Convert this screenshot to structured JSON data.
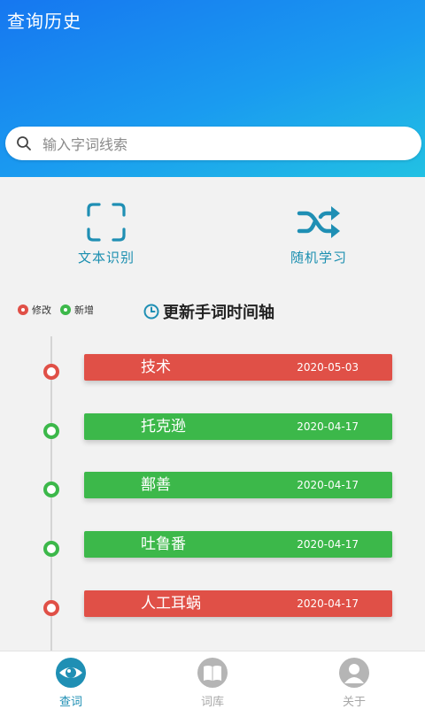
{
  "header": {
    "title": "查询历史"
  },
  "search": {
    "placeholder": "输入字词线索"
  },
  "actions": [
    {
      "label": "文本识别",
      "icon": "scan-frame-icon"
    },
    {
      "label": "随机学习",
      "icon": "shuffle-icon"
    }
  ],
  "legend": [
    {
      "label": "修改",
      "color": "#e05047"
    },
    {
      "label": "新增",
      "color": "#3cb84a"
    }
  ],
  "timeline": {
    "title": "更新手词时间轴",
    "entries": [
      {
        "word": "技术",
        "date": "2020-05-03",
        "status": "修改"
      },
      {
        "word": "托克逊",
        "date": "2020-04-17",
        "status": "新增"
      },
      {
        "word": "鄯善",
        "date": "2020-04-17",
        "status": "新增"
      },
      {
        "word": "吐鲁番",
        "date": "2020-04-17",
        "status": "新增"
      },
      {
        "word": "人工耳蜗",
        "date": "2020-04-17",
        "status": "修改"
      }
    ]
  },
  "colors": {
    "modify": "#e05047",
    "add": "#3cb84a",
    "accent": "#1b8fb0",
    "nav_inactive": "#a8a8a8"
  },
  "nav": [
    {
      "label": "查词",
      "icon": "eye-icon",
      "active": true
    },
    {
      "label": "词库",
      "icon": "book-icon",
      "active": false
    },
    {
      "label": "关于",
      "icon": "user-icon",
      "active": false
    }
  ]
}
